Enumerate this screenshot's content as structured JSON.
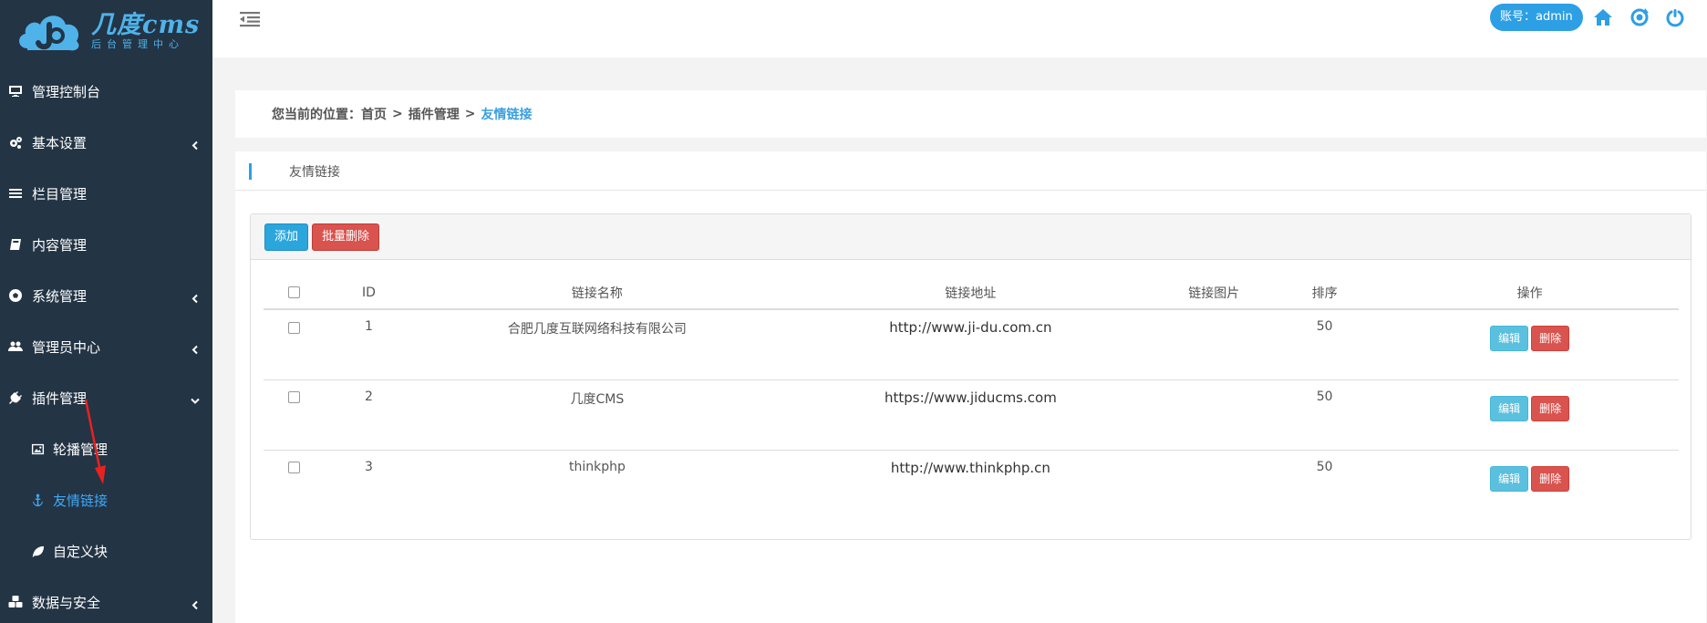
{
  "logo": {
    "title": "几度cms",
    "subtitle": "后台管理中心"
  },
  "sidebar": {
    "items": [
      {
        "label": "管理控制台",
        "icon": "desktop-icon"
      },
      {
        "label": "基本设置",
        "icon": "gears-icon"
      },
      {
        "label": "栏目管理",
        "icon": "list-icon"
      },
      {
        "label": "内容管理",
        "icon": "book-icon"
      },
      {
        "label": "系统管理",
        "icon": "soccer-ball-icon"
      },
      {
        "label": "管理员中心",
        "icon": "users-icon"
      },
      {
        "label": "插件管理",
        "icon": "plug-icon"
      },
      {
        "label": "数据与安全",
        "icon": "cubes-icon"
      }
    ],
    "sub_items": [
      {
        "label": "轮播管理",
        "icon": "image-icon"
      },
      {
        "label": "友情链接",
        "icon": "anchor-icon"
      },
      {
        "label": "自定义块",
        "icon": "leaf-icon"
      }
    ]
  },
  "topbar": {
    "account_label": "账号：admin"
  },
  "breadcrumb": {
    "prefix": "您当前的位置：",
    "home": "首页",
    "sep": ">",
    "section": "插件管理",
    "current": "友情链接"
  },
  "panel": {
    "title": "友情链接"
  },
  "toolbar": {
    "add_label": "添加",
    "batch_delete_label": "批量删除"
  },
  "table": {
    "headers": {
      "id": "ID",
      "name": "链接名称",
      "url": "链接地址",
      "image": "链接图片",
      "sort": "排序",
      "ops": "操作"
    },
    "rows": [
      {
        "id": "1",
        "name": "合肥几度互联网络科技有限公司",
        "url": "http://www.ji-du.com.cn",
        "image": "",
        "sort": "50"
      },
      {
        "id": "2",
        "name": "几度CMS",
        "url": "https://www.jiducms.com",
        "image": "",
        "sort": "50"
      },
      {
        "id": "3",
        "name": "thinkphp",
        "url": "http://www.thinkphp.cn",
        "image": "",
        "sort": "50"
      }
    ],
    "edit_label": "编辑",
    "delete_label": "删除"
  },
  "colors": {
    "sidebar_bg": "#233445",
    "accent": "#2d9fe4",
    "danger": "#d9534f",
    "info": "#5bc0de",
    "annotation_arrow": "#e8231f"
  }
}
